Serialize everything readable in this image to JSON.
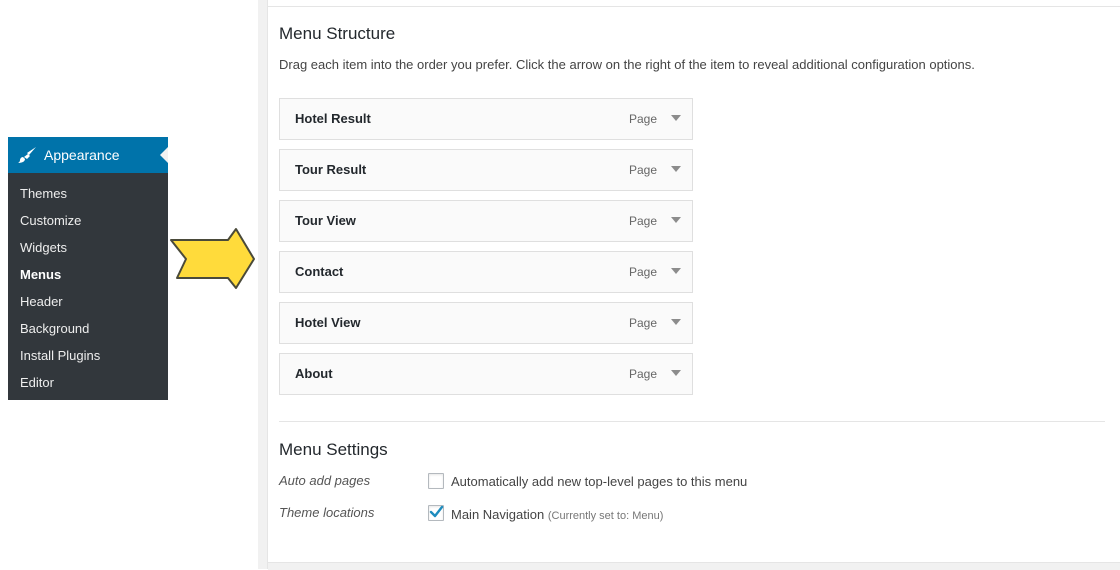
{
  "sidebar": {
    "section_title": "Appearance",
    "section_icon": "paintbrush-icon",
    "accent_color": "#0073aa",
    "background_color": "#32373c",
    "items": [
      {
        "label": "Themes",
        "current": false
      },
      {
        "label": "Customize",
        "current": false
      },
      {
        "label": "Widgets",
        "current": false
      },
      {
        "label": "Menus",
        "current": true
      },
      {
        "label": "Header",
        "current": false
      },
      {
        "label": "Background",
        "current": false
      },
      {
        "label": "Install Plugins",
        "current": false
      },
      {
        "label": "Editor",
        "current": false
      }
    ]
  },
  "annotation": {
    "icon": "pointer-arrow-icon",
    "color": "#ffdb3b"
  },
  "menu_structure": {
    "heading": "Menu Structure",
    "description": "Drag each item into the order you prefer. Click the arrow on the right of the item to reveal additional configuration options.",
    "items": [
      {
        "title": "Hotel Result",
        "type": "Page"
      },
      {
        "title": "Tour Result",
        "type": "Page"
      },
      {
        "title": "Tour View",
        "type": "Page"
      },
      {
        "title": "Contact",
        "type": "Page"
      },
      {
        "title": "Hotel View",
        "type": "Page"
      },
      {
        "title": "About",
        "type": "Page"
      }
    ]
  },
  "menu_settings": {
    "heading": "Menu Settings",
    "auto_add": {
      "label": "Auto add pages",
      "text": "Automatically add new top-level pages to this menu",
      "checked": false
    },
    "theme_locations": {
      "label": "Theme locations",
      "text": "Main Navigation",
      "note": "(Currently set to: Menu)",
      "checked": true
    },
    "check_color": "#1e8cbe"
  }
}
